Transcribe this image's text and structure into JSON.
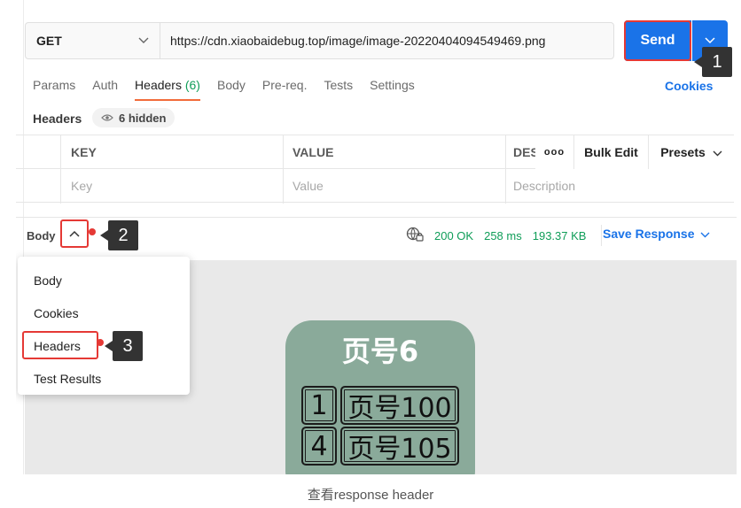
{
  "request": {
    "method": "GET",
    "url": "https://cdn.xiaobaidebug.top/image/image-20220404094549469.png",
    "send_label": "Send"
  },
  "tabs": [
    {
      "label": "Params"
    },
    {
      "label": "Auth"
    },
    {
      "label": "Headers",
      "count": "(6)"
    },
    {
      "label": "Body"
    },
    {
      "label": "Pre-req."
    },
    {
      "label": "Tests"
    },
    {
      "label": "Settings"
    }
  ],
  "cookies_label": "Cookies",
  "headers_section": {
    "title": "Headers",
    "hidden_label": "6 hidden"
  },
  "table": {
    "columns": {
      "key": "KEY",
      "value": "VALUE",
      "description": "DES"
    },
    "placeholders": {
      "key": "Key",
      "value": "Value",
      "description": "Description"
    },
    "tools": {
      "more": "ooo",
      "bulk_edit": "Bulk Edit",
      "presets": "Presets"
    }
  },
  "response": {
    "body_label": "Body",
    "status": "200 OK",
    "time": "258 ms",
    "size": "193.37 KB",
    "save_label": "Save Response"
  },
  "menu": {
    "items": [
      "Body",
      "Cookies",
      "Headers",
      "Test Results"
    ]
  },
  "preview_image": {
    "title": "页号6",
    "rows": [
      {
        "num": "1",
        "page": "页号100"
      },
      {
        "num": "4",
        "page": "页号105"
      }
    ]
  },
  "callouts": [
    "1",
    "2",
    "3"
  ],
  "caption": "查看response header",
  "colors": {
    "accent": "#1a73e8",
    "annotation": "#e53935",
    "active_tab": "#f26b3a",
    "status_ok": "#0f9d58"
  }
}
